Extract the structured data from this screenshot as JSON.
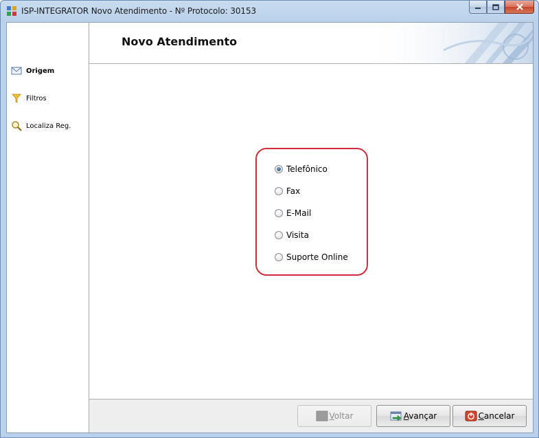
{
  "window": {
    "title": "ISP-INTEGRATOR Novo Atendimento - Nº Protocolo: 30153"
  },
  "sidebar": {
    "items": [
      {
        "label": "Origem",
        "icon": "envelope-icon",
        "active": true
      },
      {
        "label": "Filtros",
        "icon": "funnel-icon",
        "active": false
      },
      {
        "label": "Localiza Reg.",
        "icon": "magnifier-icon",
        "active": false
      }
    ]
  },
  "header": {
    "title": "Novo Atendimento"
  },
  "origin_options": {
    "selected": "Telefônico",
    "items": [
      {
        "label": "Telefônico",
        "checked": true
      },
      {
        "label": "Fax",
        "checked": false
      },
      {
        "label": "E-Mail",
        "checked": false
      },
      {
        "label": "Visita",
        "checked": false
      },
      {
        "label": "Suporte Online",
        "checked": false
      }
    ],
    "highlight_color": "#d42b3a"
  },
  "footer": {
    "back_first": "V",
    "back_rest": "oltar",
    "next_first": "A",
    "next_rest": "vançar",
    "cancel_first": "C",
    "cancel_rest": "ancelar"
  }
}
